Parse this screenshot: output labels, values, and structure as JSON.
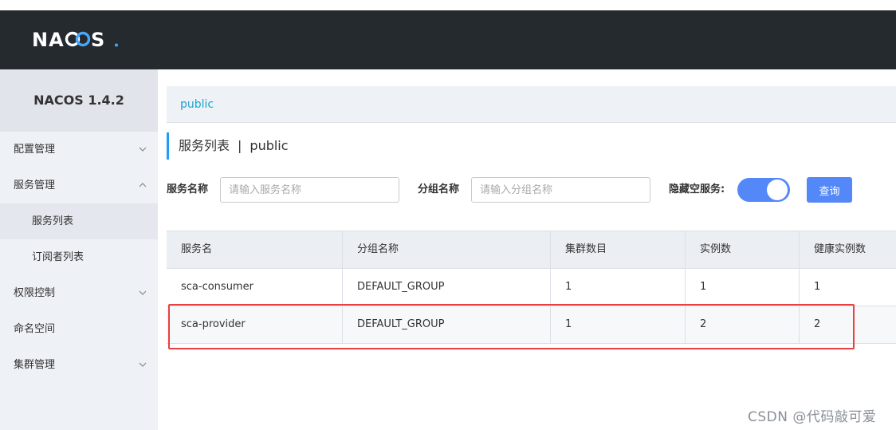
{
  "header": {
    "logo_text": "NACOS."
  },
  "sidebar": {
    "title": "NACOS 1.4.2",
    "items": [
      {
        "label": "配置管理",
        "expanded": false
      },
      {
        "label": "服务管理",
        "expanded": true
      },
      {
        "label": "服务列表",
        "sub": true,
        "active": true
      },
      {
        "label": "订阅者列表",
        "sub": true
      },
      {
        "label": "权限控制",
        "expanded": false
      },
      {
        "label": "命名空间"
      },
      {
        "label": "集群管理",
        "expanded": false
      }
    ]
  },
  "breadcrumb": {
    "namespace": "public"
  },
  "page": {
    "title": "服务列表",
    "separator": "|",
    "namespace": "public"
  },
  "filters": {
    "service_name_label": "服务名称",
    "service_name_placeholder": "请输入服务名称",
    "group_name_label": "分组名称",
    "group_name_placeholder": "请输入分组名称",
    "hide_empty_label": "隐藏空服务:",
    "hide_empty_on": true,
    "query_label": "查询"
  },
  "table": {
    "headers": [
      "服务名",
      "分组名称",
      "集群数目",
      "实例数",
      "健康实例数"
    ],
    "rows": [
      [
        "sca-consumer",
        "DEFAULT_GROUP",
        "1",
        "1",
        "1"
      ],
      [
        "sca-provider",
        "DEFAULT_GROUP",
        "1",
        "2",
        "2"
      ]
    ]
  },
  "watermark": "CSDN @代码敲可爱",
  "colors": {
    "header_bg": "#252a2f",
    "accent": "#5488f8",
    "link": "#1aa5cf",
    "highlight": "#e8403f"
  }
}
